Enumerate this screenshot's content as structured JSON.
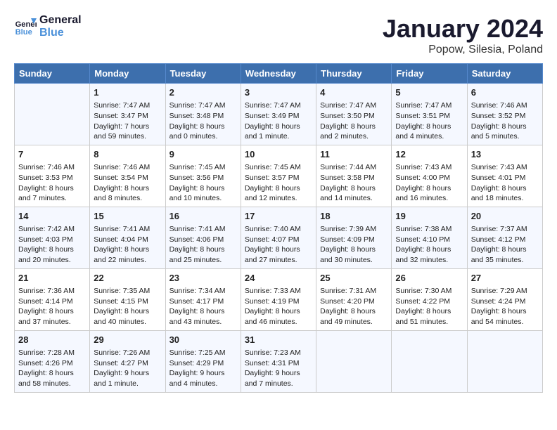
{
  "header": {
    "logo_line1": "General",
    "logo_line2": "Blue",
    "month": "January 2024",
    "location": "Popow, Silesia, Poland"
  },
  "weekdays": [
    "Sunday",
    "Monday",
    "Tuesday",
    "Wednesday",
    "Thursday",
    "Friday",
    "Saturday"
  ],
  "weeks": [
    [
      {
        "day": "",
        "info": ""
      },
      {
        "day": "1",
        "info": "Sunrise: 7:47 AM\nSunset: 3:47 PM\nDaylight: 7 hours\nand 59 minutes."
      },
      {
        "day": "2",
        "info": "Sunrise: 7:47 AM\nSunset: 3:48 PM\nDaylight: 8 hours\nand 0 minutes."
      },
      {
        "day": "3",
        "info": "Sunrise: 7:47 AM\nSunset: 3:49 PM\nDaylight: 8 hours\nand 1 minute."
      },
      {
        "day": "4",
        "info": "Sunrise: 7:47 AM\nSunset: 3:50 PM\nDaylight: 8 hours\nand 2 minutes."
      },
      {
        "day": "5",
        "info": "Sunrise: 7:47 AM\nSunset: 3:51 PM\nDaylight: 8 hours\nand 4 minutes."
      },
      {
        "day": "6",
        "info": "Sunrise: 7:46 AM\nSunset: 3:52 PM\nDaylight: 8 hours\nand 5 minutes."
      }
    ],
    [
      {
        "day": "7",
        "info": "Sunrise: 7:46 AM\nSunset: 3:53 PM\nDaylight: 8 hours\nand 7 minutes."
      },
      {
        "day": "8",
        "info": "Sunrise: 7:46 AM\nSunset: 3:54 PM\nDaylight: 8 hours\nand 8 minutes."
      },
      {
        "day": "9",
        "info": "Sunrise: 7:45 AM\nSunset: 3:56 PM\nDaylight: 8 hours\nand 10 minutes."
      },
      {
        "day": "10",
        "info": "Sunrise: 7:45 AM\nSunset: 3:57 PM\nDaylight: 8 hours\nand 12 minutes."
      },
      {
        "day": "11",
        "info": "Sunrise: 7:44 AM\nSunset: 3:58 PM\nDaylight: 8 hours\nand 14 minutes."
      },
      {
        "day": "12",
        "info": "Sunrise: 7:43 AM\nSunset: 4:00 PM\nDaylight: 8 hours\nand 16 minutes."
      },
      {
        "day": "13",
        "info": "Sunrise: 7:43 AM\nSunset: 4:01 PM\nDaylight: 8 hours\nand 18 minutes."
      }
    ],
    [
      {
        "day": "14",
        "info": "Sunrise: 7:42 AM\nSunset: 4:03 PM\nDaylight: 8 hours\nand 20 minutes."
      },
      {
        "day": "15",
        "info": "Sunrise: 7:41 AM\nSunset: 4:04 PM\nDaylight: 8 hours\nand 22 minutes."
      },
      {
        "day": "16",
        "info": "Sunrise: 7:41 AM\nSunset: 4:06 PM\nDaylight: 8 hours\nand 25 minutes."
      },
      {
        "day": "17",
        "info": "Sunrise: 7:40 AM\nSunset: 4:07 PM\nDaylight: 8 hours\nand 27 minutes."
      },
      {
        "day": "18",
        "info": "Sunrise: 7:39 AM\nSunset: 4:09 PM\nDaylight: 8 hours\nand 30 minutes."
      },
      {
        "day": "19",
        "info": "Sunrise: 7:38 AM\nSunset: 4:10 PM\nDaylight: 8 hours\nand 32 minutes."
      },
      {
        "day": "20",
        "info": "Sunrise: 7:37 AM\nSunset: 4:12 PM\nDaylight: 8 hours\nand 35 minutes."
      }
    ],
    [
      {
        "day": "21",
        "info": "Sunrise: 7:36 AM\nSunset: 4:14 PM\nDaylight: 8 hours\nand 37 minutes."
      },
      {
        "day": "22",
        "info": "Sunrise: 7:35 AM\nSunset: 4:15 PM\nDaylight: 8 hours\nand 40 minutes."
      },
      {
        "day": "23",
        "info": "Sunrise: 7:34 AM\nSunset: 4:17 PM\nDaylight: 8 hours\nand 43 minutes."
      },
      {
        "day": "24",
        "info": "Sunrise: 7:33 AM\nSunset: 4:19 PM\nDaylight: 8 hours\nand 46 minutes."
      },
      {
        "day": "25",
        "info": "Sunrise: 7:31 AM\nSunset: 4:20 PM\nDaylight: 8 hours\nand 49 minutes."
      },
      {
        "day": "26",
        "info": "Sunrise: 7:30 AM\nSunset: 4:22 PM\nDaylight: 8 hours\nand 51 minutes."
      },
      {
        "day": "27",
        "info": "Sunrise: 7:29 AM\nSunset: 4:24 PM\nDaylight: 8 hours\nand 54 minutes."
      }
    ],
    [
      {
        "day": "28",
        "info": "Sunrise: 7:28 AM\nSunset: 4:26 PM\nDaylight: 8 hours\nand 58 minutes."
      },
      {
        "day": "29",
        "info": "Sunrise: 7:26 AM\nSunset: 4:27 PM\nDaylight: 9 hours\nand 1 minute."
      },
      {
        "day": "30",
        "info": "Sunrise: 7:25 AM\nSunset: 4:29 PM\nDaylight: 9 hours\nand 4 minutes."
      },
      {
        "day": "31",
        "info": "Sunrise: 7:23 AM\nSunset: 4:31 PM\nDaylight: 9 hours\nand 7 minutes."
      },
      {
        "day": "",
        "info": ""
      },
      {
        "day": "",
        "info": ""
      },
      {
        "day": "",
        "info": ""
      }
    ]
  ]
}
